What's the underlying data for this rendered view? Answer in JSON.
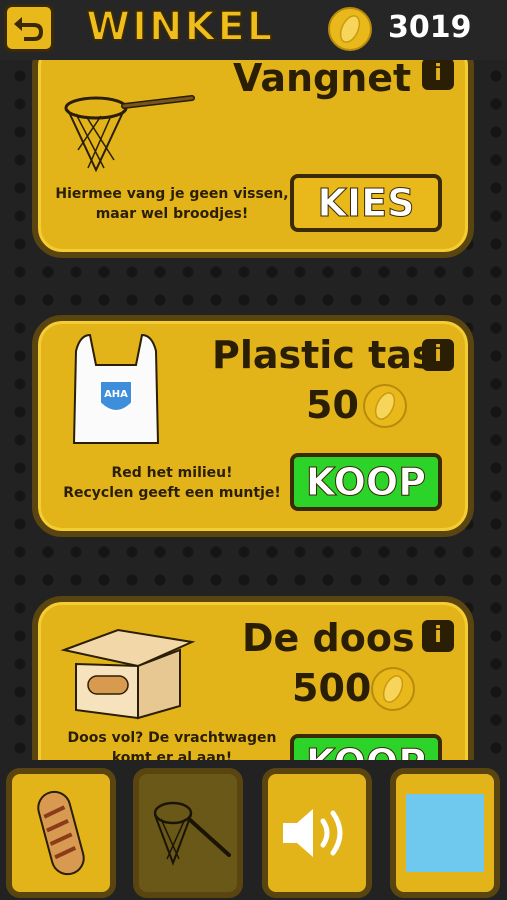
{
  "header": {
    "title": "WINKEL",
    "coins": "3019"
  },
  "items": [
    {
      "name": "Vangnet",
      "description_line1": "Hiermee vang je geen vissen,",
      "description_line2": "maar wel broodjes!",
      "action": "KIES",
      "info": "i"
    },
    {
      "name": "Plastic tas",
      "price": "50",
      "description_line1": "Red het milieu!",
      "description_line2": "Recyclen geeft een muntje!",
      "action": "KOOP",
      "info": "i",
      "bag_label": "AHA"
    },
    {
      "name": "De doos",
      "price": "500",
      "description_line1": "Doos vol? De vrachtwagen",
      "description_line2": "komt er al aan!",
      "action": "KOOP",
      "info": "i"
    }
  ],
  "tabs": [
    {
      "icon": "sausage-roll-icon",
      "selected": false
    },
    {
      "icon": "net-icon",
      "selected": true
    },
    {
      "icon": "speaker-icon",
      "selected": false
    },
    {
      "icon": "blue-square-icon",
      "selected": false
    }
  ],
  "colors": {
    "gold": "#e3b41a",
    "dark": "#2a1e04",
    "green": "#2cd42a",
    "sky": "#6fc9ef"
  }
}
